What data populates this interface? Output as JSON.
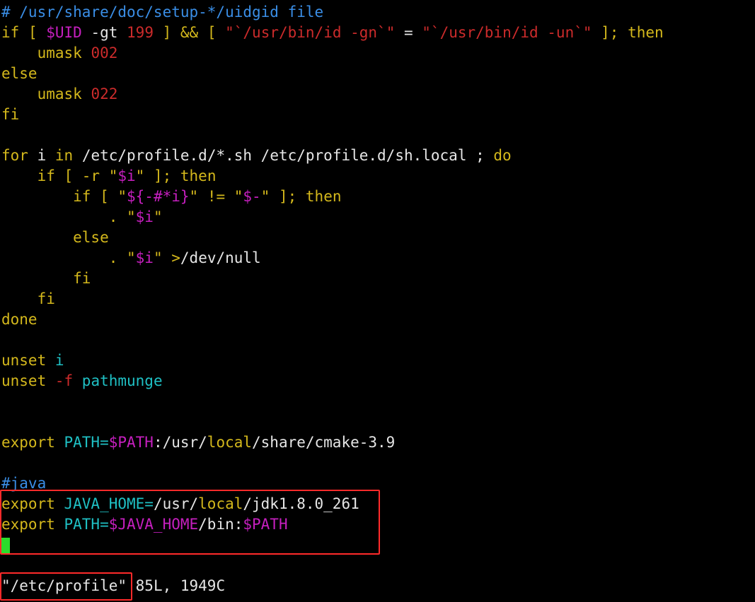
{
  "editor": {
    "lines": {
      "l1": "# /usr/share/doc/setup-*/uidgid file",
      "l2_if": "if",
      "l2_br": " [ ",
      "l2_uid": "$UID",
      "l2_gt": " -gt ",
      "l2_199": "199",
      "l2_mid": " ] && [ ",
      "l2_q1": "\"`/usr/bin/id -gn`\"",
      "l2_eq": " = ",
      "l2_q2": "\"`/usr/bin/id -un`\"",
      "l2_end": " ]; ",
      "l2_then": "then",
      "l3_umask": "    umask ",
      "l3_val": "002",
      "l4": "else",
      "l5_umask": "    umask ",
      "l5_val": "022",
      "l6": "fi",
      "l8_for": "for",
      "l8_i": " i ",
      "l8_in": "in",
      "l8_rest": " /etc/profile.d/*.sh /etc/profile.d/sh.local ; ",
      "l8_do": "do",
      "l9_if": "    if",
      "l9_br": " [ -r \"",
      "l9_var": "$i",
      "l9_end": "\" ]; ",
      "l9_then": "then",
      "l10_if": "        if",
      "l10_br": " [ \"",
      "l10_var": "${-#*i}",
      "l10_ne": "\" != \"",
      "l10_var2": "$-",
      "l10_end": "\" ]; ",
      "l10_then": "then",
      "l11_dot": "            . \"",
      "l11_var": "$i",
      "l11_end": "\"",
      "l12": "        else",
      "l13_dot": "            . \"",
      "l13_var": "$i",
      "l13_q": "\" ",
      "l13_gt": ">",
      "l13_path": "/dev/null",
      "l14": "        fi",
      "l15": "    fi",
      "l16": "done",
      "l18_unset": "unset",
      "l18_i": " i",
      "l19_unset": "unset",
      "l19_f": " -f",
      "l19_name": " pathmunge",
      "l22_export": "export",
      "l22_path": " PATH=",
      "l22_var": "$PATH",
      "l22_a": ":/usr/",
      "l22_local": "local",
      "l22_b": "/share/cmake-3.9",
      "l24": "#java",
      "l25_export": "export",
      "l25_jh": " JAVA_HOME=",
      "l25_a": "/usr/",
      "l25_local": "local",
      "l25_b": "/jdk1.8.0_261",
      "l26_export": "export",
      "l26_path": " PATH=",
      "l26_var": "$JAVA_HOME",
      "l26_bin": "/bin:",
      "l26_var2": "$PATH"
    },
    "status": {
      "filename": "\"/etc/profile\"",
      "info": " 85L, 1949C"
    }
  },
  "colors": {
    "comment": "#3a8ee6",
    "keyword": "#d4b81c",
    "variable": "#c61fbf",
    "number": "#cc2b2b",
    "identifier": "#1fc0c4",
    "highlight_box": "#ff2a2a",
    "cursor": "#2bdc2b"
  }
}
